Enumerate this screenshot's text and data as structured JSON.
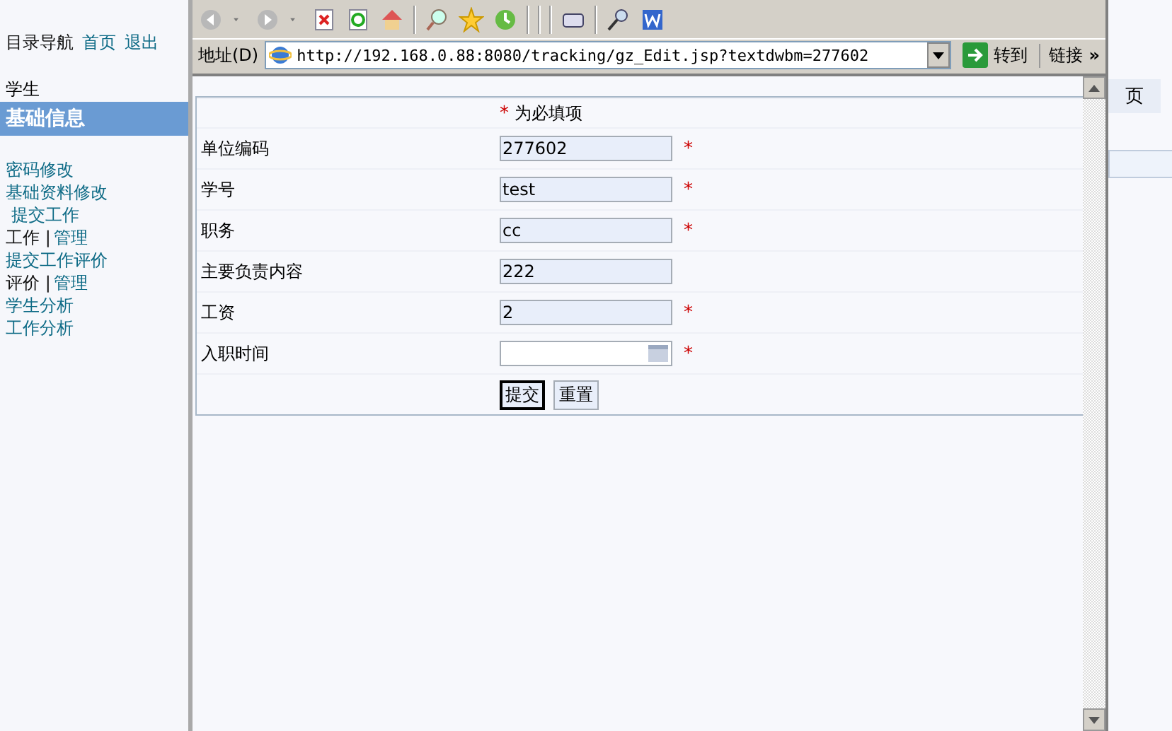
{
  "sidebar": {
    "title": "目录导航",
    "top_links": [
      "首页",
      "退出"
    ],
    "role": "学生",
    "section": "基础信息",
    "menu": [
      [
        {
          "text": "密码修改",
          "link": true
        }
      ],
      [
        {
          "text": "基础资料修改",
          "link": true
        }
      ],
      [
        {
          "text": "提交工作",
          "link": true
        }
      ],
      [
        {
          "text": "工作 |",
          "link": false
        },
        {
          "text": "管理",
          "link": true
        }
      ],
      [
        {
          "text": "提交工作评价",
          "link": true
        }
      ],
      [
        {
          "text": "评价 |",
          "link": false
        },
        {
          "text": "管理",
          "link": true
        }
      ],
      [
        {
          "text": "学生分析",
          "link": true
        }
      ],
      [
        {
          "text": "工作分析",
          "link": true
        }
      ]
    ]
  },
  "browser": {
    "address_label": "地址(D)",
    "url": "http://192.168.0.88:8080/tracking/gz_Edit.jsp?textdwbm=277602",
    "go": "转到",
    "links": "链接",
    "more": "»"
  },
  "form": {
    "required_note": "为必填项",
    "required_mark": "*",
    "fields": [
      {
        "label": "单位编码",
        "kind": "text",
        "value": "277602",
        "required": true
      },
      {
        "label": "学号",
        "kind": "text",
        "value": "test",
        "required": true
      },
      {
        "label": "职务",
        "kind": "text",
        "value": "cc",
        "required": true
      },
      {
        "label": "主要负责内容",
        "kind": "text",
        "value": "222",
        "required": false
      },
      {
        "label": "工资",
        "kind": "text",
        "value": "2",
        "required": true
      },
      {
        "label": "入职时间",
        "kind": "date",
        "required": true
      }
    ],
    "buttons": [
      {
        "label": "提交",
        "focused": true
      },
      {
        "label": "重置",
        "focused": false
      }
    ]
  },
  "background_page": {
    "tab": "页"
  }
}
